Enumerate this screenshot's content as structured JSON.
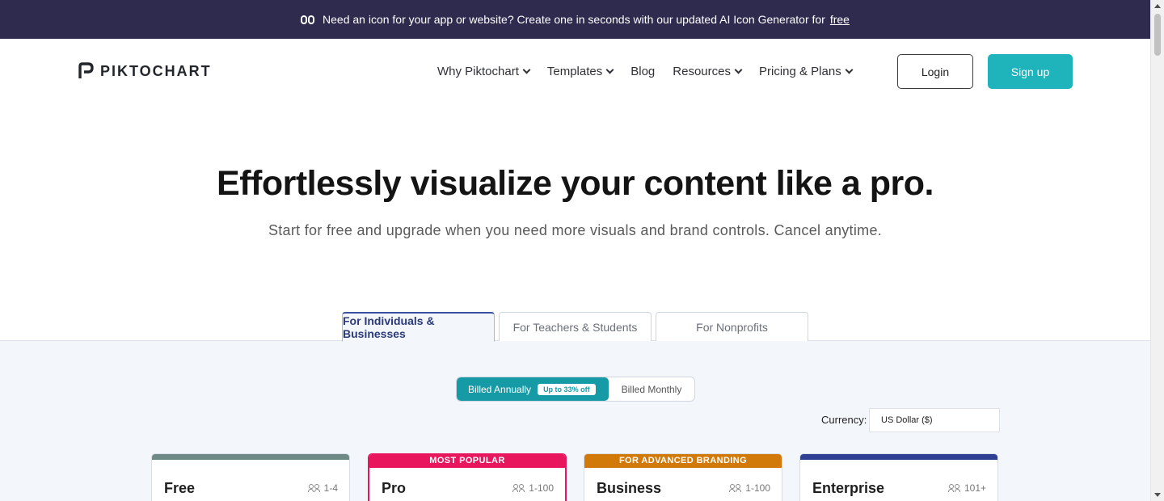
{
  "announcement": {
    "text": "Need an icon for your app or website? Create one in seconds with our updated AI Icon Generator for",
    "link": "free"
  },
  "header": {
    "logo_text": "PIKTOCHART",
    "menu": [
      {
        "label": "Why Piktochart",
        "dropdown": true
      },
      {
        "label": "Templates",
        "dropdown": true
      },
      {
        "label": "Blog",
        "dropdown": false
      },
      {
        "label": "Resources",
        "dropdown": true
      },
      {
        "label": "Pricing & Plans",
        "dropdown": true
      }
    ],
    "login_label": "Login",
    "signup_label": "Sign up"
  },
  "hero": {
    "title": "Effortlessly visualize your content like a pro.",
    "subtitle": "Start for free and upgrade when you need more visuals and brand controls. Cancel anytime."
  },
  "audience_tabs": [
    {
      "label": "For Individuals & Businesses",
      "active": true
    },
    {
      "label": "For Teachers & Students",
      "active": false
    },
    {
      "label": "For Nonprofits",
      "active": false
    }
  ],
  "billing": {
    "annual_label": "Billed Annually",
    "annual_badge": "Up to 33% off",
    "monthly_label": "Billed Monthly",
    "selected": "annual"
  },
  "currency": {
    "label": "Currency:",
    "value": "US Dollar ($)"
  },
  "plans": [
    {
      "name": "Free",
      "users": "1-4",
      "banner": "",
      "color": "#6f8a86"
    },
    {
      "name": "Pro",
      "users": "1-100",
      "banner": "MOST POPULAR",
      "color": "#e8175d"
    },
    {
      "name": "Business",
      "users": "1-100",
      "banner": "FOR ADVANCED BRANDING",
      "color": "#d17a0a"
    },
    {
      "name": "Enterprise",
      "users": "101+",
      "banner": "",
      "color": "#2f3f93"
    }
  ],
  "colors": {
    "announcement_bg": "#2f2b4f",
    "accent": "#1fb3bc",
    "billing_active": "#169ba6"
  }
}
